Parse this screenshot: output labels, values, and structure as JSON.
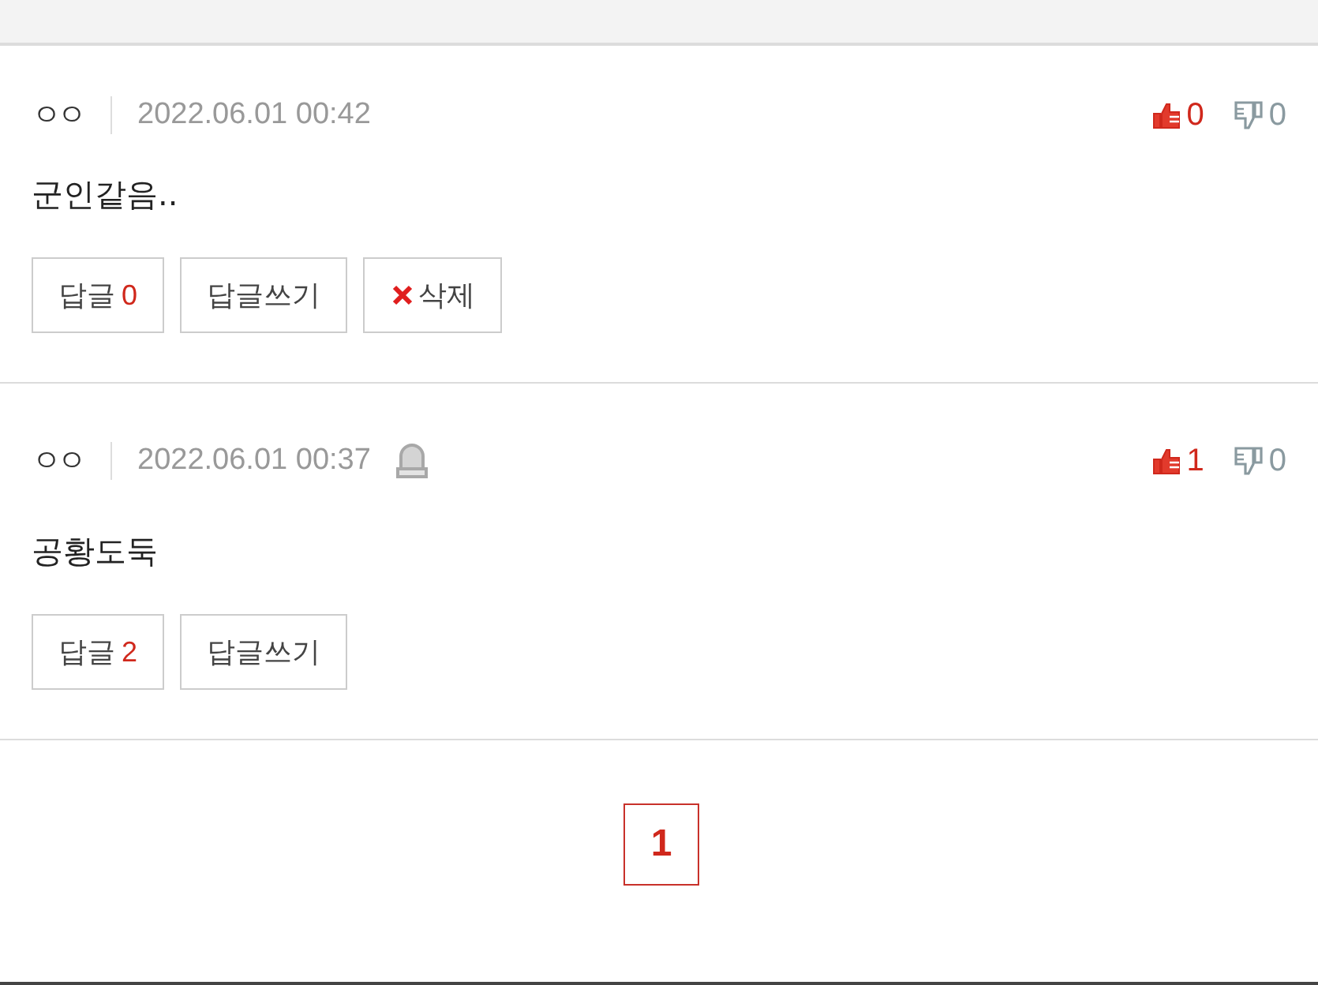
{
  "comments": [
    {
      "author": "ㅇㅇ",
      "date": "2022.06.01 00:42",
      "marked": false,
      "likes": "0",
      "dislikes": "0",
      "text": "군인같음..",
      "actions": [
        {
          "kind": "replies",
          "label": "답글",
          "count": "0"
        },
        {
          "kind": "write",
          "label": "답글쓰기"
        },
        {
          "kind": "delete",
          "label": "삭제"
        }
      ]
    },
    {
      "author": "ㅇㅇ",
      "date": "2022.06.01 00:37",
      "marked": true,
      "likes": "1",
      "dislikes": "0",
      "text": "공황도둑",
      "actions": [
        {
          "kind": "replies",
          "label": "답글",
          "count": "2"
        },
        {
          "kind": "write",
          "label": "답글쓰기"
        }
      ]
    }
  ],
  "pagination": [
    {
      "label": "1",
      "selected": true
    }
  ]
}
